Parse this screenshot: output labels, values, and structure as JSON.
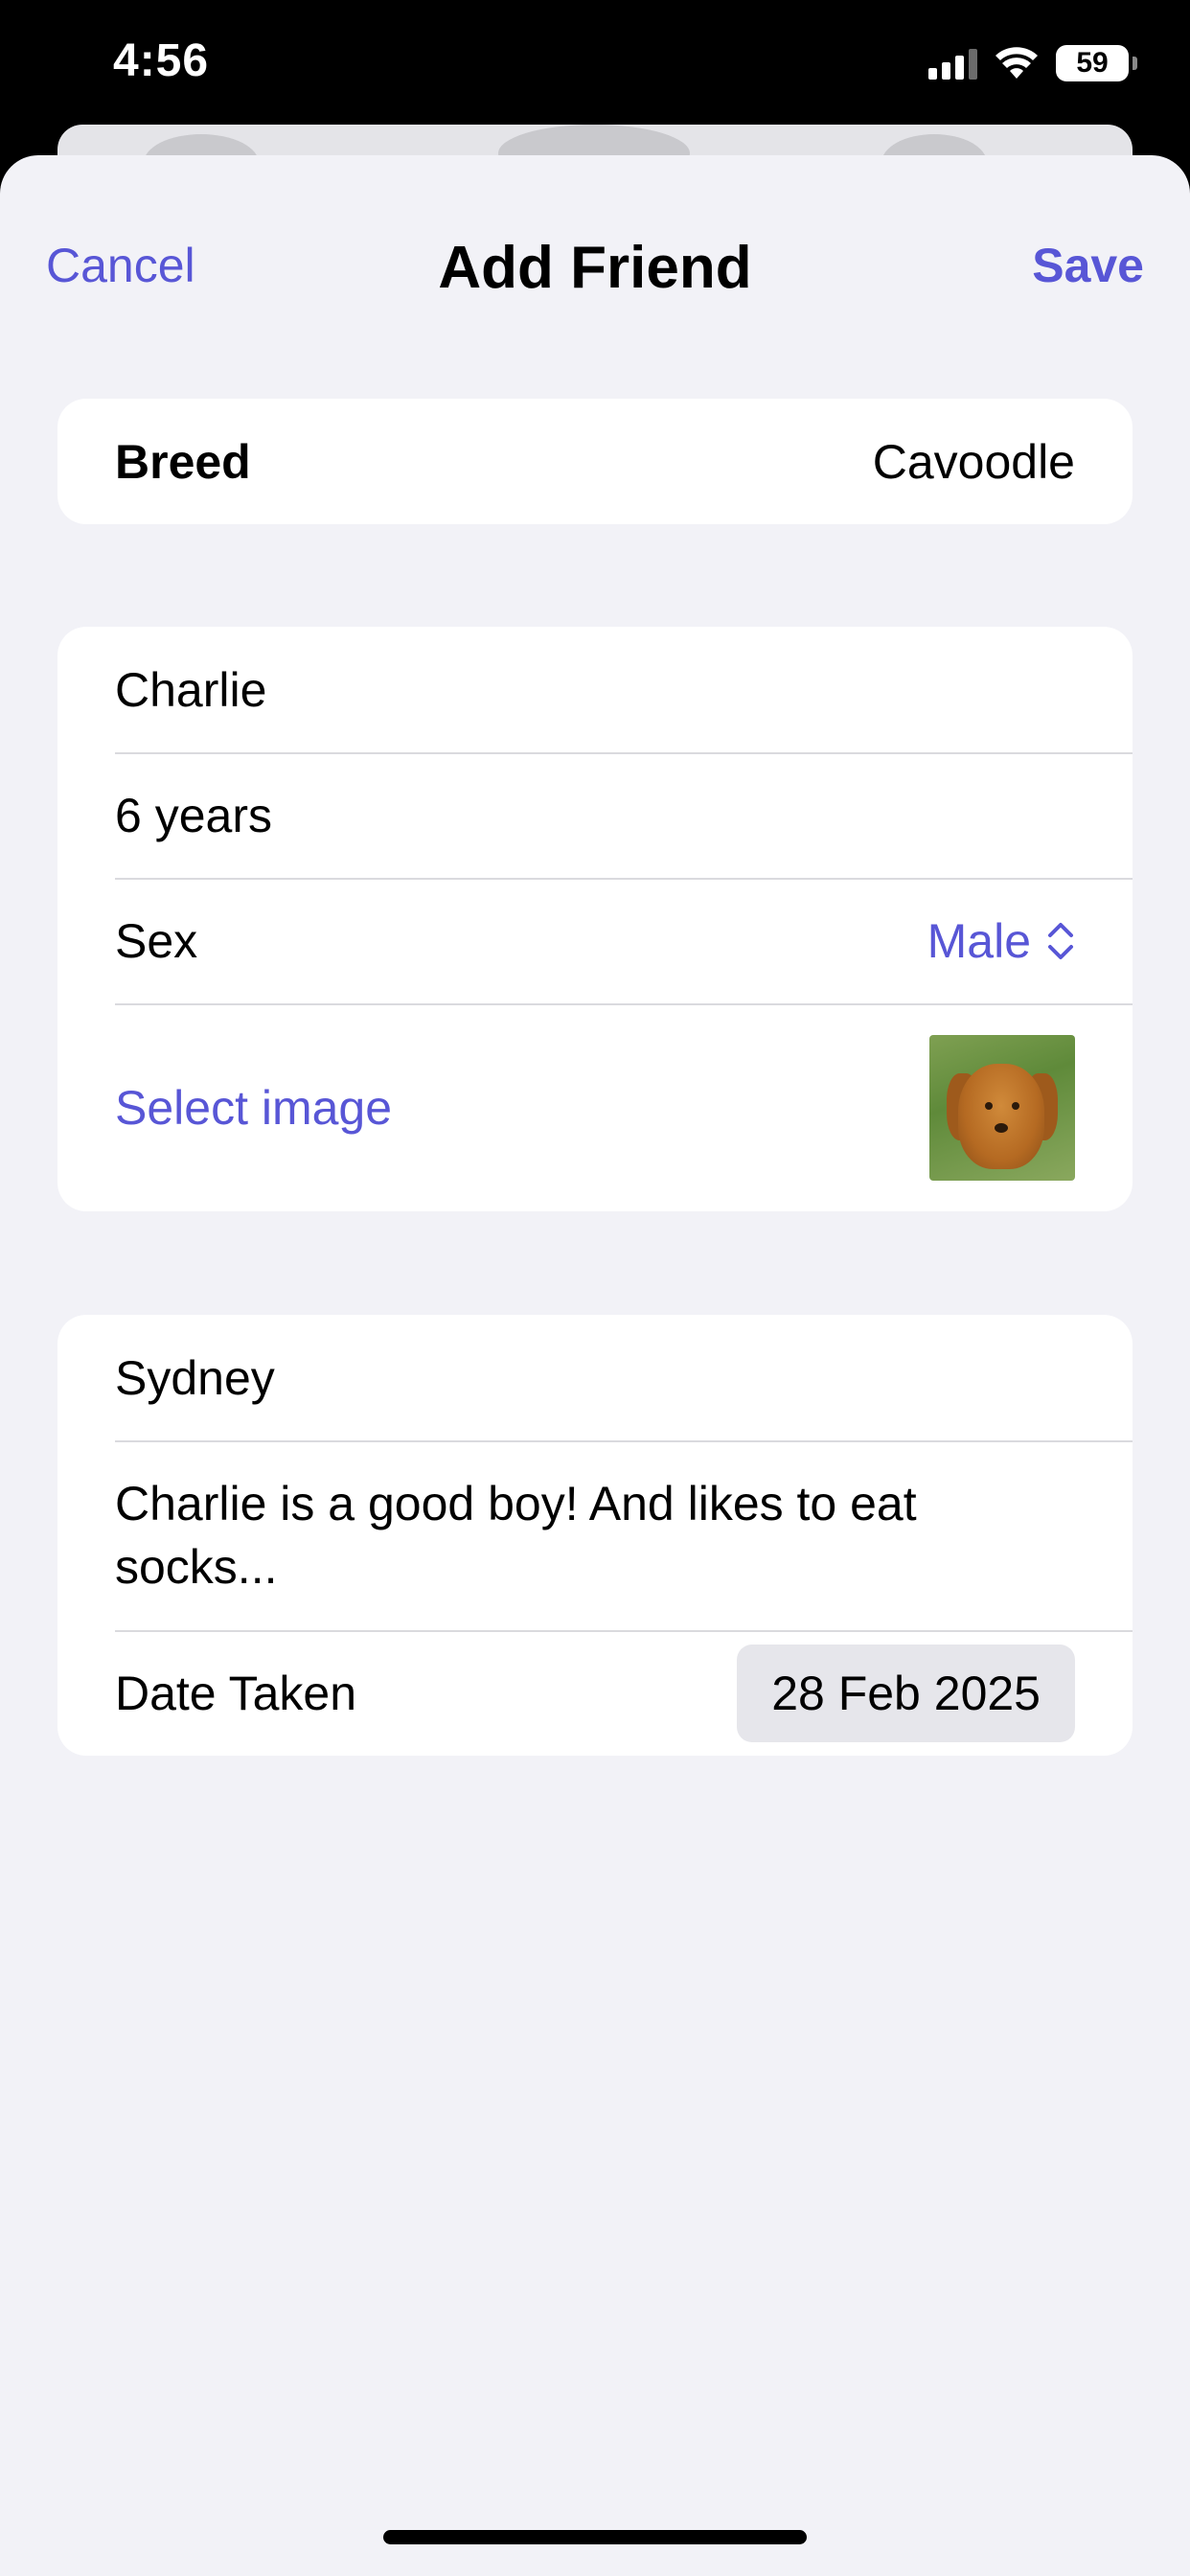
{
  "status_bar": {
    "time": "4:56",
    "battery": "59"
  },
  "nav": {
    "cancel_label": "Cancel",
    "title": "Add Friend",
    "save_label": "Save"
  },
  "breed_section": {
    "label": "Breed",
    "value": "Cavoodle"
  },
  "details_section": {
    "name": "Charlie",
    "age": "6 years",
    "sex_label": "Sex",
    "sex_value": "Male",
    "select_image_label": "Select image"
  },
  "photo_section": {
    "location": "Sydney",
    "notes": "Charlie is a good boy! And likes to eat socks...",
    "date_label": "Date Taken",
    "date_value": "28 Feb 2025"
  },
  "colors": {
    "accent": "#5856d6",
    "background": "#f2f2f7",
    "card": "#ffffff"
  },
  "icons": [
    "signal-icon",
    "wifi-icon",
    "battery-icon",
    "chevron-up-down-icon",
    "dog-photo-thumbnail"
  ]
}
